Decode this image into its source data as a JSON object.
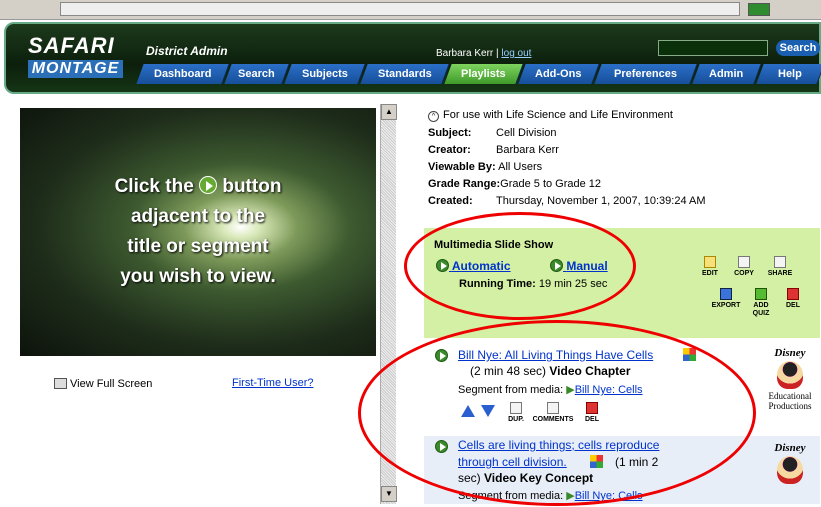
{
  "header": {
    "logo_top": "SAFARI",
    "logo_bottom": "MONTAGE",
    "district": "District Admin",
    "user": "Barbara Kerr",
    "separator": "|",
    "logout": "log out",
    "search_button": "Search"
  },
  "nav": [
    {
      "label": "Dashboard",
      "active": false
    },
    {
      "label": "Search",
      "active": false
    },
    {
      "label": "Subjects",
      "active": false
    },
    {
      "label": "Standards",
      "active": false
    },
    {
      "label": "Playlists",
      "active": true
    },
    {
      "label": "Add-Ons",
      "active": false
    },
    {
      "label": "Preferences",
      "active": false
    },
    {
      "label": "Admin",
      "active": false
    },
    {
      "label": "Help",
      "active": false
    }
  ],
  "video": {
    "line1a": "Click the",
    "line1b": "button",
    "line2": "adjacent to the",
    "line3": "title or segment",
    "line4": "you wish to view.",
    "fullscreen": "View Full Screen",
    "first_time": "First-Time User?"
  },
  "info": {
    "note": "For use with Life Science and Life Environment",
    "subject_label": "Subject:",
    "subject": "Cell Division",
    "creator_label": "Creator:",
    "creator": "Barbara Kerr",
    "viewable_label": "Viewable By:",
    "viewable": "All Users",
    "grade_label": "Grade Range:",
    "grade": "Grade 5 to Grade 12",
    "created_label": "Created:",
    "created": "Thursday, November 1, 2007, 10:39:24 AM"
  },
  "slideshow": {
    "title": "Multimedia Slide Show",
    "automatic": "Automatic",
    "manual": "Manual",
    "running_label": "Running Time:",
    "running_value": "19 min 25 sec",
    "tools": {
      "edit": "EDIT",
      "copy": "COPY",
      "share": "SHARE",
      "export": "EXPORT",
      "add_quiz": "ADD QUIZ",
      "del": "DEL"
    }
  },
  "items": [
    {
      "title": "Bill Nye: All Living Things Have Cells",
      "duration": "(2 min 48 sec)",
      "type": "Video Chapter",
      "segment_label": "Segment from media:",
      "media": "Bill Nye: Cells",
      "logo": "Disney",
      "logo_sub1": "Educational",
      "logo_sub2": "Productions",
      "tools": {
        "dup": "DUP.",
        "comments": "COMMENTS",
        "del": "DEL"
      }
    },
    {
      "title_line1": "Cells are living things; cells reproduce",
      "title_line2": "through cell division.",
      "duration": "(1 min 2",
      "duration2": "sec)",
      "type": "Video Key Concept",
      "segment_label": "Segment from media:",
      "media": "Bill Nye: Cells",
      "logo": "Disney"
    }
  ],
  "colors": {
    "nav_blue": "#2b6fc7",
    "nav_active": "#6bc24a",
    "slideshow_bg": "#d3f0a4",
    "annotation": "#ee0000"
  }
}
